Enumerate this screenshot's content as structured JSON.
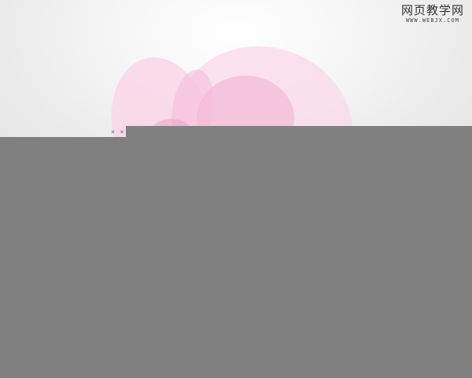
{
  "watermark": {
    "title": "网页教学网",
    "url": "WWW.WEBJX.COM"
  },
  "cursor": {
    "marker": "× ×"
  },
  "colors": {
    "overlay": "#808080",
    "petal_light": "#fbd7e8",
    "petal_mid": "#f4b6d6",
    "petal_deep": "#ee9fca"
  },
  "icons": {
    "cursor": "cross-cursor-icon"
  }
}
